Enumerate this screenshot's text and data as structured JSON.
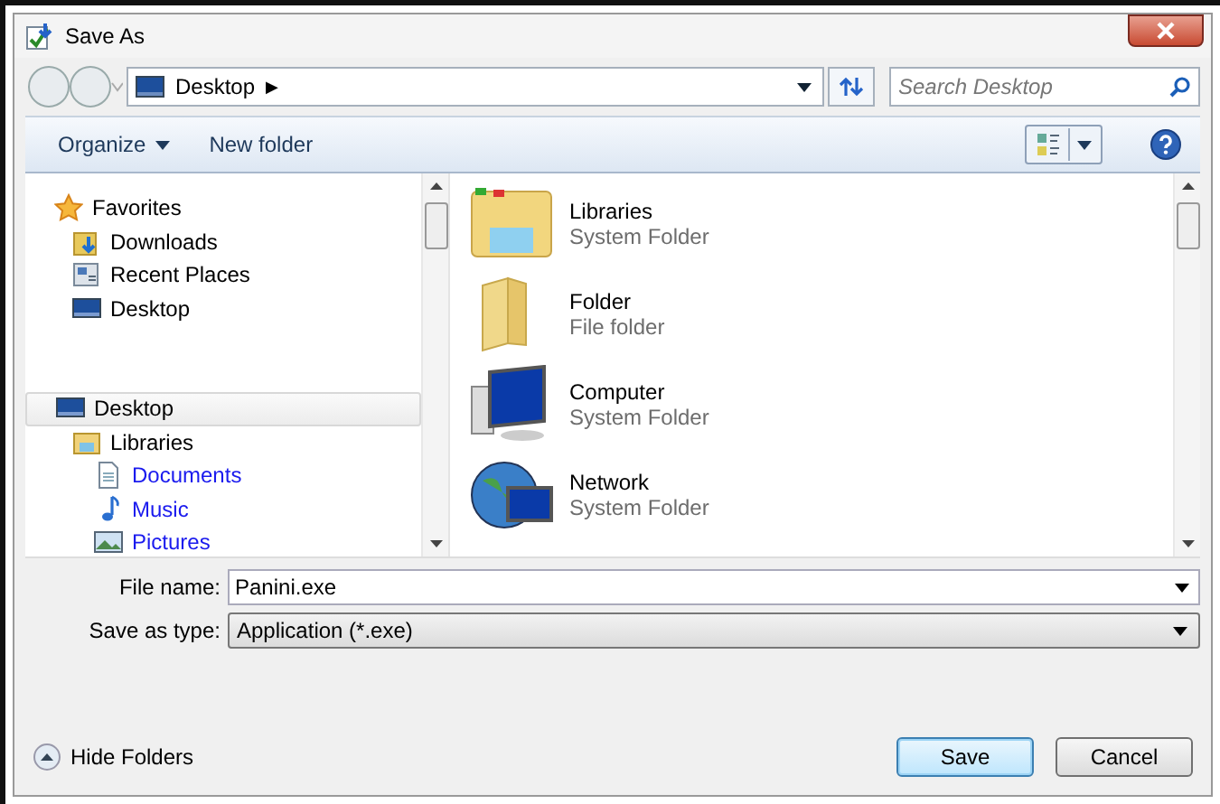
{
  "window": {
    "title": "Save As"
  },
  "address_bar": {
    "location": "Desktop",
    "separator": "▶"
  },
  "search": {
    "placeholder": "Search Desktop"
  },
  "toolbar": {
    "organize": "Organize",
    "new_folder": "New folder"
  },
  "navigation": [
    {
      "kind": "favorites",
      "label": "Favorites",
      "selected": false,
      "highlighted": false,
      "children": [
        {
          "kind": "downloads",
          "label": "Downloads",
          "selected": false,
          "highlighted": false
        },
        {
          "kind": "recent",
          "label": "Recent Places",
          "selected": false,
          "highlighted": false
        },
        {
          "kind": "desktop",
          "label": "Desktop",
          "selected": false,
          "highlighted": false
        }
      ]
    },
    {
      "kind": "desktop",
      "label": "Desktop",
      "selected": true,
      "highlighted": false,
      "children": [
        {
          "kind": "libraries",
          "label": "Libraries",
          "selected": false,
          "highlighted": false,
          "children": [
            {
              "kind": "documents",
              "label": "Documents",
              "selected": false,
              "highlighted": true
            },
            {
              "kind": "music",
              "label": "Music",
              "selected": false,
              "highlighted": true
            },
            {
              "kind": "pictures",
              "label": "Pictures",
              "selected": false,
              "highlighted": true
            }
          ]
        }
      ]
    }
  ],
  "files": [
    {
      "kind": "libraries",
      "name": "Libraries",
      "type": "System Folder"
    },
    {
      "kind": "folder",
      "name": "Folder",
      "type": "File folder"
    },
    {
      "kind": "computer",
      "name": "Computer",
      "type": "System Folder"
    },
    {
      "kind": "network",
      "name": "Network",
      "type": "System Folder"
    }
  ],
  "form": {
    "file_name_label": "File name:",
    "file_name": "Panini.exe",
    "type_label": "Save as type:",
    "type": "Application (*.exe)"
  },
  "footer": {
    "hide_folders": "Hide Folders",
    "save": "Save",
    "cancel": "Cancel"
  }
}
